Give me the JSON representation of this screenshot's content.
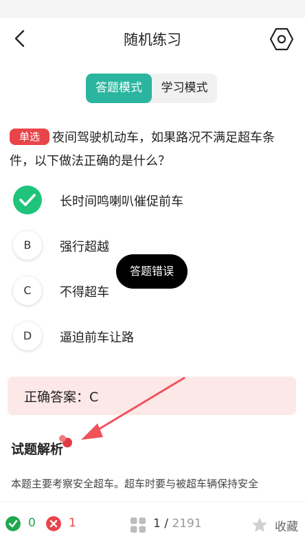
{
  "header": {
    "title": "随机练习"
  },
  "modes": {
    "active": "答题模式",
    "inactive": "学习模式"
  },
  "question": {
    "type_badge": "单选",
    "text": "夜间驾驶机动车，如果路况不满足超车条件，以下做法正确的是什么？"
  },
  "options": [
    {
      "letter": "",
      "text": "长时间鸣喇叭催促前车"
    },
    {
      "letter": "B",
      "text": "强行超越"
    },
    {
      "letter": "C",
      "text": "不得超车"
    },
    {
      "letter": "D",
      "text": "逼迫前车让路"
    }
  ],
  "toast": "答题错误",
  "answer": {
    "text": "正确答案：C"
  },
  "analysis": {
    "title": "试题解析",
    "text": "本题主要考察安全超车。超车时要与被超车辆保持安全"
  },
  "bottom": {
    "correct_count": "0",
    "wrong_count": "1",
    "current": "1",
    "total": "2191",
    "favorite_label": "收藏"
  },
  "colors": {
    "accent": "#2bb5a0",
    "correct": "#1fc47a",
    "wrong": "#e8454a"
  }
}
